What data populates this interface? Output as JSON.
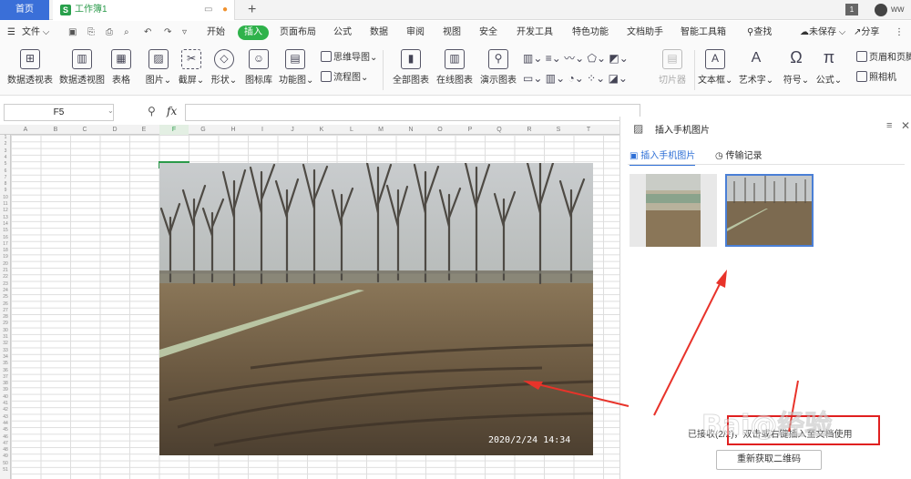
{
  "tabs": {
    "home": "首页",
    "workbook": "工作簿1"
  },
  "menu": {
    "file": "文件",
    "items": [
      "开始",
      "插入",
      "页面布局",
      "公式",
      "数据",
      "审阅",
      "视图",
      "安全",
      "开发工具",
      "特色功能",
      "文档助手",
      "智能工具箱"
    ],
    "search": "查找",
    "unsaved": "未保存",
    "share": "分享"
  },
  "ribbon": {
    "pivot_table": "数据透视表",
    "pivot_chart": "数据透视图",
    "table": "表格",
    "picture": "图片",
    "screenshot": "截屏",
    "shape": "形状",
    "icon_lib": "图标库",
    "function_chart": "功能图",
    "mindmap": "思维导图",
    "flowchart": "流程图",
    "all_charts": "全部图表",
    "online_charts": "在线图表",
    "demo_chart": "演示图表",
    "slicer": "切片器",
    "textbox": "文本框",
    "wordart": "艺术字",
    "symbol": "符号",
    "formula": "公式",
    "header_footer": "页眉和页脚",
    "camera": "照相机"
  },
  "formula_bar": {
    "cell_ref": "F5",
    "fx": "fx",
    "value": ""
  },
  "sheet": {
    "columns": [
      "A",
      "B",
      "C",
      "D",
      "E",
      "F",
      "G",
      "H",
      "I",
      "J",
      "K",
      "L",
      "M",
      "N",
      "O",
      "P",
      "Q",
      "R",
      "S",
      "T"
    ]
  },
  "photo": {
    "timestamp": "2020/2/24  14:34"
  },
  "panel": {
    "title": "插入手机图片",
    "tab_insert": "插入手机图片",
    "tab_history": "传输记录",
    "hint": "已接收(2/2)，双击或右键插入至文档使用",
    "refresh_button": "重新获取二维码"
  },
  "watermark": {
    "text": "Bai@经验"
  },
  "colors": {
    "accent_green": "#2fb24b",
    "home_tab": "#3a6fd8",
    "arrow": "#e8332a",
    "highlight": "#e02020"
  }
}
